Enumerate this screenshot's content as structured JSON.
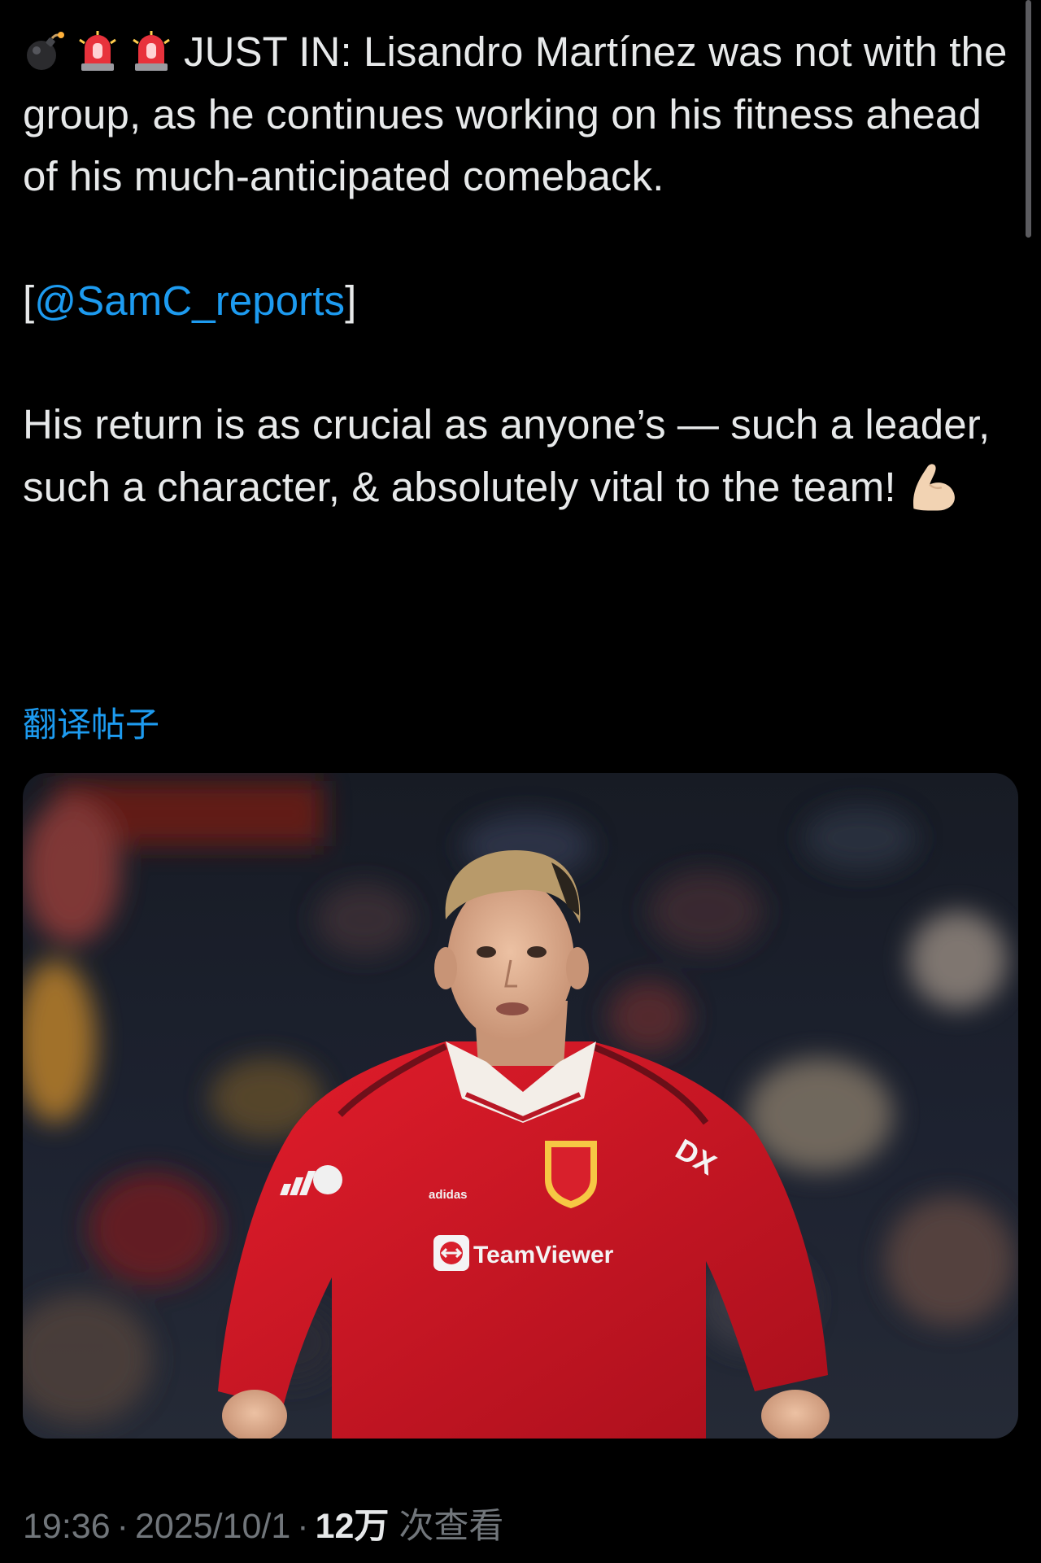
{
  "tweet": {
    "icons": [
      "bomb-icon",
      "police-light-icon",
      "police-light-icon"
    ],
    "paragraph1": "JUST IN: Lisandro Martínez was not with the group, as he continues working on his fitness ahead of his much-anticipated comeback.",
    "source_open": "[",
    "source_mention": "@SamC_reports",
    "source_close": "]",
    "paragraph3": "His return is as crucial as anyone’s — such a leader, such a character, & absolutely vital to the team!",
    "paragraph3_icon": "flexed-biceps-icon"
  },
  "translate_label": "翻译帖子",
  "photo": {
    "shirt_sponsor": "TeamViewer",
    "kit_brand": "adidas"
  },
  "meta": {
    "time": "19:36",
    "separator": "·",
    "date": "2025/10/1",
    "view_count": "12万",
    "view_label": "次查看"
  },
  "colors": {
    "background": "#000000",
    "text": "#e7e9ea",
    "link": "#1d9bf0",
    "secondary": "#71767b"
  }
}
